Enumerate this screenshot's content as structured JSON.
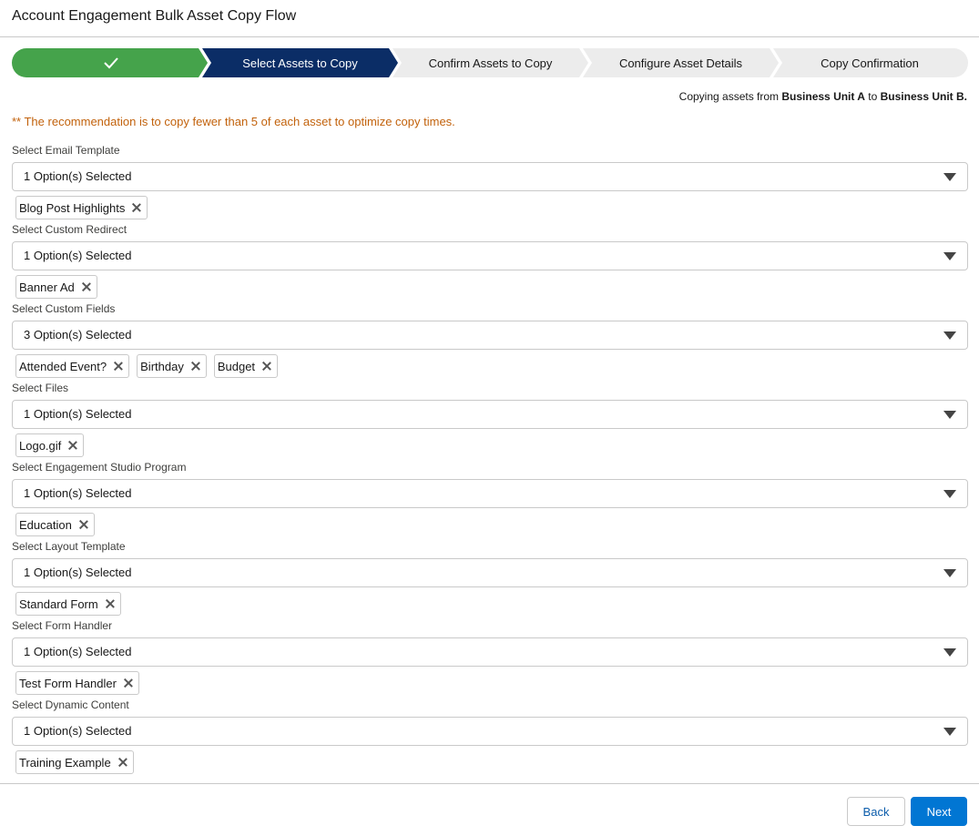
{
  "window": {
    "title": "Account Engagement Bulk Asset Copy Flow"
  },
  "path": {
    "steps": [
      {
        "label": "",
        "state": "complete",
        "icon": "check-icon"
      },
      {
        "label": "Select Assets to Copy",
        "state": "current"
      },
      {
        "label": "Confirm Assets to Copy",
        "state": "incomplete"
      },
      {
        "label": "Configure Asset Details",
        "state": "incomplete"
      },
      {
        "label": "Copy Confirmation",
        "state": "incomplete"
      }
    ],
    "colors": {
      "complete": "#45a34b",
      "current": "#0b2d66",
      "incomplete": "#ececec"
    }
  },
  "copy_info": {
    "prefix": "Copying assets from ",
    "source": "Business Unit A",
    "middle": " to ",
    "target": "Business Unit B."
  },
  "recommendation": "** The recommendation is to copy fewer than 5 of each asset to optimize copy times.",
  "fields": [
    {
      "label": "Select Email Template",
      "value": "1 Option(s) Selected",
      "pills": [
        "Blog Post Highlights"
      ]
    },
    {
      "label": "Select Custom Redirect",
      "value": "1 Option(s) Selected",
      "pills": [
        "Banner Ad"
      ]
    },
    {
      "label": "Select Custom Fields",
      "value": "3 Option(s) Selected",
      "pills": [
        "Attended Event?",
        "Birthday",
        "Budget"
      ]
    },
    {
      "label": "Select Files",
      "value": "1 Option(s) Selected",
      "pills": [
        "Logo.gif"
      ]
    },
    {
      "label": "Select Engagement Studio Program",
      "value": "1 Option(s) Selected",
      "pills": [
        "Education"
      ]
    },
    {
      "label": "Select Layout Template",
      "value": "1 Option(s) Selected",
      "pills": [
        "Standard Form"
      ]
    },
    {
      "label": "Select Form Handler",
      "value": "1 Option(s) Selected",
      "pills": [
        "Test Form Handler"
      ]
    },
    {
      "label": "Select Dynamic Content",
      "value": "1 Option(s) Selected",
      "pills": [
        "Training Example"
      ]
    }
  ],
  "footer": {
    "back_label": "Back",
    "next_label": "Next"
  },
  "colors": {
    "accent": "#0176d3",
    "warning_text": "#c2620c"
  }
}
